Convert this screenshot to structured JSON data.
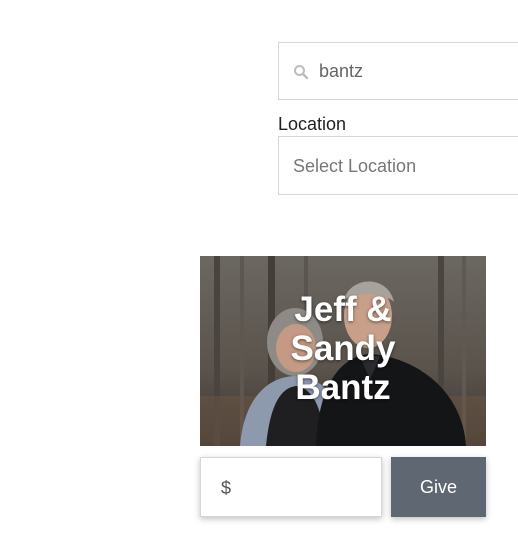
{
  "search": {
    "value": "bantz",
    "icon": "search-icon"
  },
  "location": {
    "label": "Location",
    "selected": "Select Location"
  },
  "profile": {
    "name_lines": [
      "Jeff &",
      "Sandy",
      "Bantz"
    ]
  },
  "donation": {
    "currency_prefix": "$",
    "give_label": "Give"
  }
}
